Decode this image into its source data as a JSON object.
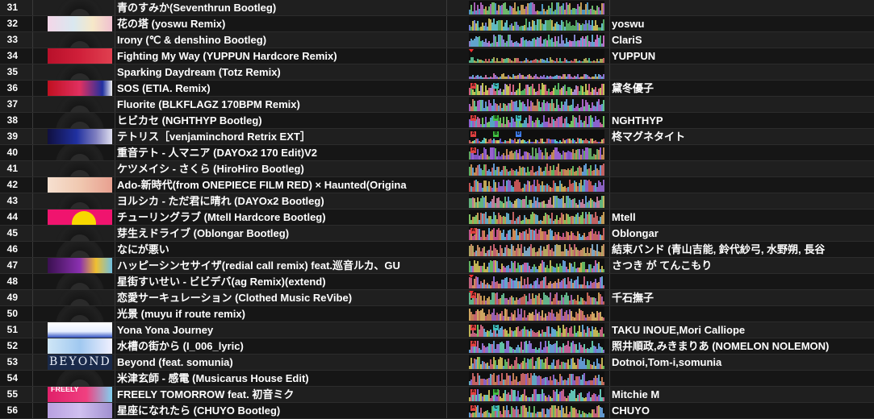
{
  "tracks": [
    {
      "no": "31",
      "title": "青のすみか(Seventhrun Bootleg)",
      "artist": "",
      "art": "",
      "cues": [],
      "palette": [
        "#7dd67a",
        "#5aaee0",
        "#c070d0",
        "#e0b060"
      ]
    },
    {
      "no": "32",
      "title": "花の塔 (yoswu Remix)",
      "artist": "yoswu",
      "art": "art-pastel",
      "cues": [],
      "palette": [
        "#6fd8e0",
        "#8090f0",
        "#60c070",
        "#e0d060"
      ]
    },
    {
      "no": "33",
      "title": "Irony (℃ & denshino Bootleg)",
      "artist": "ClariS",
      "art": "",
      "cues": [],
      "palette": [
        "#9a9af0",
        "#70c0f0",
        "#e080e0",
        "#60d090"
      ]
    },
    {
      "no": "34",
      "title": "Fighting My Way (YUPPUN Hardcore Remix)",
      "artist": "YUPPUN",
      "art": "art-red",
      "cues": [
        "marker"
      ],
      "palette": [
        "#c0c060",
        "#70b0f0",
        "#e07070",
        "#60d0a0"
      ]
    },
    {
      "no": "35",
      "title": "Sparking Daydream (Totz Remix)",
      "artist": "",
      "art": "",
      "cues": [],
      "palette": [
        "#e080c0",
        "#70c0f0",
        "#a080f0",
        "#e0c060"
      ]
    },
    {
      "no": "36",
      "title": "SOS (ETIA. Remix)",
      "artist": "黛冬優子",
      "art": "art-redpink",
      "cues": [
        "A",
        "C"
      ],
      "palette": [
        "#60d070",
        "#f07090",
        "#c0a0f0",
        "#e0e060"
      ]
    },
    {
      "no": "37",
      "title": "Fluorite (BLKFLAGZ 170BPM Remix)",
      "artist": "",
      "art": "",
      "cues": [],
      "palette": [
        "#c070e0",
        "#70b0f0",
        "#e09070",
        "#70e0a0"
      ]
    },
    {
      "no": "38",
      "title": "ヒビカセ (NGHTHYP Bootleg)",
      "artist": "NGHTHYP",
      "art": "",
      "cues": [
        "A",
        "B",
        "C"
      ],
      "palette": [
        "#a070f0",
        "#60c0e0",
        "#e070b0",
        "#80e070"
      ]
    },
    {
      "no": "39",
      "title": "テトリス［venjaminchord Retrix EXT］",
      "artist": "柊マグネタイト",
      "art": "art-navy",
      "cues": [
        "A",
        "B",
        "D"
      ],
      "palette": [
        "#7070f0",
        "#60e0e0",
        "#e0e070",
        "#e07070"
      ]
    },
    {
      "no": "40",
      "title": "重音テト - 人マニア (DAYOx2 170 Edit)V2",
      "artist": "",
      "art": "",
      "cues": [
        "A"
      ],
      "palette": [
        "#b070f0",
        "#9060e0",
        "#70c070",
        "#e0a060"
      ]
    },
    {
      "no": "41",
      "title": "ケツメイシ - さくら (HiroHiro Bootleg)",
      "artist": "",
      "art": "",
      "cues": [],
      "palette": [
        "#e0a060",
        "#70d070",
        "#70b0f0",
        "#e07070"
      ]
    },
    {
      "no": "42",
      "title": "Ado-新時代(from ONEPIECE FILM RED) × Haunted(Origina",
      "artist": "",
      "art": "art-peach",
      "cues": [],
      "palette": [
        "#e06060",
        "#e0c060",
        "#60c0e0",
        "#a070e0"
      ]
    },
    {
      "no": "43",
      "title": "ヨルシカ - ただ君に晴れ (DAYOx2 Bootleg)",
      "artist": "",
      "art": "",
      "cues": [],
      "palette": [
        "#70d090",
        "#70b0f0",
        "#e090b0",
        "#e0d070"
      ]
    },
    {
      "no": "44",
      "title": "チューリングラブ (Mtell Hardcore Bootleg)",
      "artist": "Mtell",
      "art": "art-magenta",
      "cues": [],
      "palette": [
        "#e0b060",
        "#e07070",
        "#70c0e0",
        "#90e070"
      ]
    },
    {
      "no": "45",
      "title": "芽生えドライブ (Oblongar Bootleg)",
      "artist": "Oblongar",
      "art": "",
      "cues": [
        "A"
      ],
      "palette": [
        "#e07070",
        "#f0a060",
        "#e060a0",
        "#70c0f0"
      ]
    },
    {
      "no": "46",
      "title": "なにが悪い",
      "artist": "結束バンド (青山吉能, 鈴代紗弓, 水野朔, 長谷",
      "art": "",
      "cues": [],
      "palette": [
        "#e0a070",
        "#d0c070",
        "#e07080",
        "#90c0e0"
      ]
    },
    {
      "no": "47",
      "title": "ハッピーシンセサイザ(redial call remix) feat.巡音ルカ、GU",
      "artist": "さつき が てんこもり",
      "art": "art-purple",
      "cues": [],
      "palette": [
        "#70d070",
        "#e0d060",
        "#70b0f0",
        "#e070c0"
      ]
    },
    {
      "no": "48",
      "title": "星街すいせい - ビビデバ(ag Remix)(extend)",
      "artist": "",
      "art": "",
      "cues": [
        "marker"
      ],
      "palette": [
        "#e07090",
        "#f0a070",
        "#70c0f0",
        "#a080f0"
      ]
    },
    {
      "no": "49",
      "title": "恋愛サーキュレーション (Clothed Music ReVibe)",
      "artist": "千石撫子",
      "art": "",
      "cues": [
        "marker",
        "A"
      ],
      "palette": [
        "#e07060",
        "#e0b060",
        "#c070c0",
        "#70d0a0"
      ]
    },
    {
      "no": "50",
      "title": "光景 (muyu if route remix)",
      "artist": "",
      "art": "",
      "cues": [],
      "palette": [
        "#e07080",
        "#e09060",
        "#f0c070",
        "#b070d0"
      ]
    },
    {
      "no": "51",
      "title": "Yona Yona Journey",
      "artist": "TAKU INOUE,Mori Calliope",
      "art": "art-white",
      "cues": [
        "A",
        "C"
      ],
      "palette": [
        "#80e070",
        "#e0d060",
        "#70c0f0",
        "#e07090"
      ]
    },
    {
      "no": "52",
      "title": "水槽の街から (I_006_lyric)",
      "artist": "照井順政,みきまりあ (NOMELON NOLEMON)",
      "art": "art-skyblue",
      "cues": [
        "A"
      ],
      "palette": [
        "#70b0f0",
        "#a080f0",
        "#e070b0",
        "#70e0c0"
      ]
    },
    {
      "no": "53",
      "title": "Beyond (feat. somunia)",
      "artist": "Dotnoi,Tom-i,somunia",
      "art": "art-beyond",
      "cues": [],
      "palette": [
        "#e0d060",
        "#70d070",
        "#e07080",
        "#70b0f0"
      ]
    },
    {
      "no": "54",
      "title": "米津玄師 - 感電 (Musicarus House Edit)",
      "artist": "",
      "art": "",
      "cues": [],
      "palette": [
        "#e09060",
        "#e07070",
        "#a070e0",
        "#70c0e0"
      ]
    },
    {
      "no": "55",
      "title": "FREELY TOMORROW feat. 初音ミク",
      "artist": "Mitchie M",
      "art": "art-freely",
      "cues": [
        "A",
        "B"
      ],
      "palette": [
        "#70e0d0",
        "#e070a0",
        "#e0d060",
        "#9070f0"
      ]
    },
    {
      "no": "56",
      "title": "星座になれたら (CHUYO Bootleg)",
      "artist": "CHUYO",
      "art": "art-lavender",
      "cues": [
        "A",
        "C"
      ],
      "palette": [
        "#70d070",
        "#70b0f0",
        "#e0c060",
        "#e07090"
      ]
    }
  ],
  "art_text": {
    "beyond": "BEYOND",
    "freely": "FREELY"
  },
  "cue_colors": {
    "A": "#e04040",
    "B": "#40c040",
    "C": "#40c0c0",
    "D": "#4080f0"
  }
}
